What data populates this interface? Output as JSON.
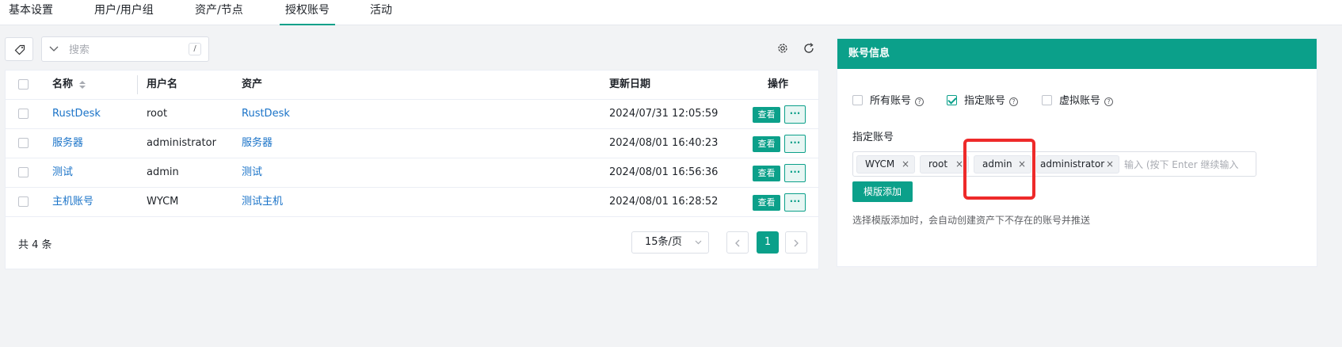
{
  "tabs": [
    {
      "label": "基本设置",
      "active": false
    },
    {
      "label": "用户/用户组",
      "active": false
    },
    {
      "label": "资产/节点",
      "active": false
    },
    {
      "label": "授权账号",
      "active": true
    },
    {
      "label": "活动",
      "active": false
    }
  ],
  "toolbar": {
    "tag_icon": "tag-icon",
    "search_placeholder": "搜索",
    "search_shortcut": "/",
    "settings_icon": "gear-icon",
    "refresh_icon": "refresh-icon"
  },
  "table": {
    "columns": [
      "名称",
      "用户名",
      "资产",
      "更新日期",
      "操作"
    ],
    "rows": [
      {
        "name": "RustDesk",
        "username": "root",
        "asset": "RustDesk",
        "updated": "2024/07/31 12:05:59"
      },
      {
        "name": "服务器",
        "username": "administrator",
        "asset": "服务器",
        "updated": "2024/08/01 16:40:23"
      },
      {
        "name": "测试",
        "username": "admin",
        "asset": "测试",
        "updated": "2024/08/01 16:56:36"
      },
      {
        "name": "主机账号",
        "username": "WYCM",
        "asset": "测试主机",
        "updated": "2024/08/01 16:28:52"
      }
    ],
    "view_label": "查看",
    "more_label": "···"
  },
  "pagination": {
    "total_text": "共 4 条",
    "page_size": "15条/页",
    "current_page": "1"
  },
  "account_panel": {
    "title": "账号信息",
    "options": [
      {
        "label": "所有账号",
        "checked": false
      },
      {
        "label": "指定账号",
        "checked": true
      },
      {
        "label": "虚拟账号",
        "checked": false
      }
    ],
    "help_glyph": "?",
    "specified_label": "指定账号",
    "tags": [
      "WYCM",
      "root",
      "admin",
      "administrator"
    ],
    "tag_close": "×",
    "input_placeholder": "输入 (按下 Enter 继续输入",
    "template_button": "模版添加",
    "hint": "选择模版添加时，会自动创建资产下不存在的账号并推送"
  },
  "colors": {
    "accent": "#0ba08a",
    "link": "#1a73c8",
    "highlight": "#ee2a2a"
  }
}
